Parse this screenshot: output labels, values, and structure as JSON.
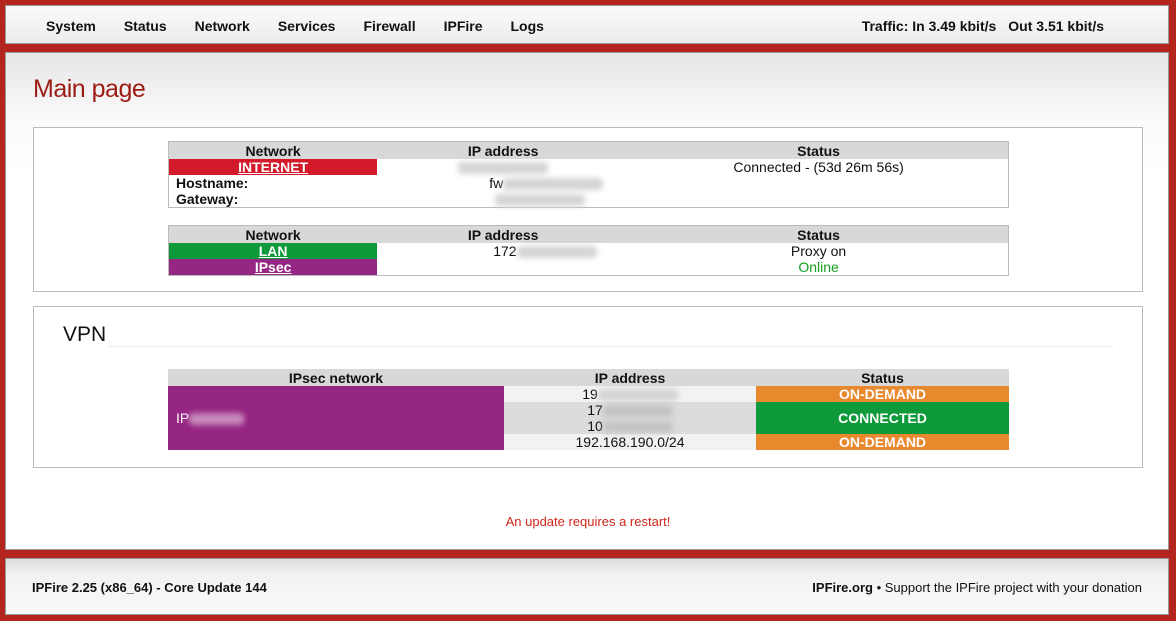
{
  "nav": {
    "items": [
      "System",
      "Status",
      "Network",
      "Services",
      "Firewall",
      "IPFire",
      "Logs"
    ],
    "traffic_in": "Traffic: In 3.49 kbit/s",
    "traffic_out": "Out 3.51 kbit/s"
  },
  "page": {
    "title": "Main page"
  },
  "networks": {
    "header": {
      "network": "Network",
      "ip": "IP address",
      "status": "Status"
    },
    "internet": {
      "label": "INTERNET",
      "status": "Connected - (53d 26m 56s)",
      "hostname_label": "Hostname:",
      "hostname_prefix": "fw",
      "gateway_label": "Gateway:"
    },
    "lan": {
      "label": "LAN",
      "ip_prefix": "172",
      "status": "Proxy on"
    },
    "ipsec": {
      "label": "IPsec",
      "status": "Online"
    }
  },
  "vpn": {
    "title": "VPN",
    "header": {
      "network": "IPsec network",
      "ip": "IP address",
      "status": "Status"
    },
    "network_prefix": "IP",
    "rows": [
      {
        "ip": "19",
        "status": "ON-DEMAND"
      },
      {
        "ip": "17",
        "status": "CONNECTED"
      },
      {
        "ip": "10",
        "status": ""
      },
      {
        "ip": "192.168.190.0/24",
        "status": "ON-DEMAND"
      }
    ]
  },
  "notice": "An update requires a restart!",
  "footer": {
    "version": "IPFire 2.25 (x86_64) - Core Update 144",
    "site": "IPFire.org",
    "support": " • Support the IPFire project with your donation"
  },
  "colors": {
    "brand_red": "#b3261e",
    "internet": "#d21a2b",
    "lan": "#0e9a3b",
    "ipsec": "#952683",
    "on_demand": "#e8892e",
    "connected": "#0e9a3b"
  }
}
